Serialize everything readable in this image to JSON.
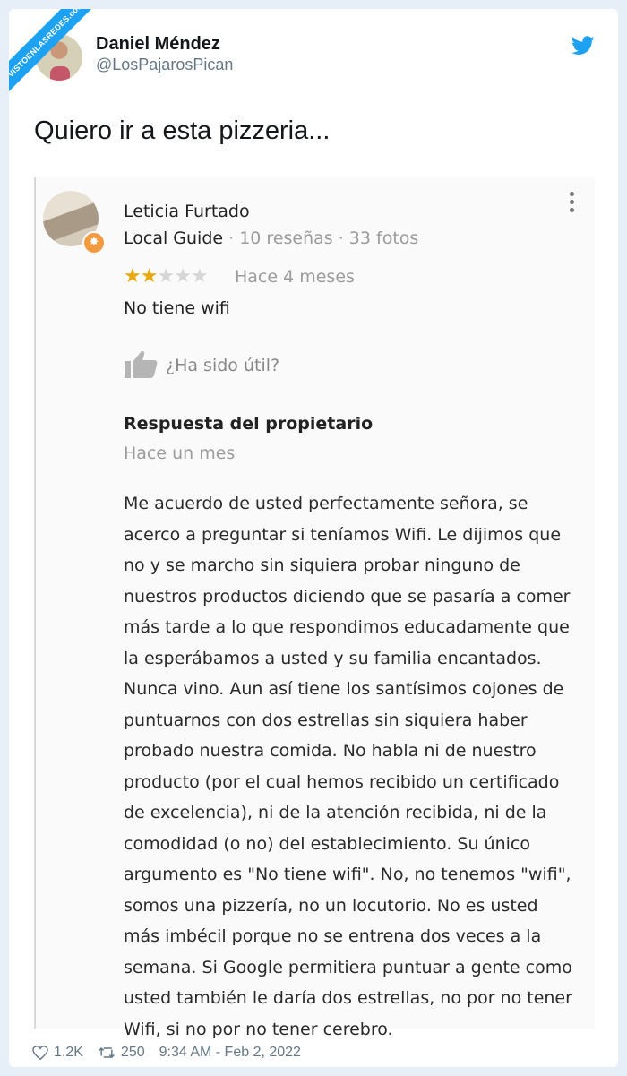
{
  "watermark": "VISTOENLASREDES.com",
  "tweet": {
    "author_name": "Daniel Méndez",
    "author_handle": "@LosPajarosPican",
    "text": "Quiero ir a esta pizzeria...",
    "likes": "1.2K",
    "retweets": "250",
    "timestamp": "9:34 AM - Feb 2, 2022"
  },
  "review": {
    "reviewer_name": "Leticia Furtado",
    "reviewer_level": "Local Guide",
    "reviewer_stats": "· 10 reseñas · 33 fotos",
    "rating": 2,
    "rating_max": 5,
    "time_ago": "Hace 4 meses",
    "text": "No tiene wifi",
    "helpful_label": "¿Ha sido útil?"
  },
  "owner_response": {
    "title": "Respuesta del propietario",
    "time_ago": "Hace un mes",
    "lines": [
      "Me acuerdo de usted perfectamente señora, se",
      "acerco a preguntar si teníamos Wifi. Le dijimos que",
      "no y se marcho sin siquiera probar ninguno de",
      "nuestros productos diciendo que se pasaría a comer",
      "más tarde a lo que respondimos educadamente que",
      "la esperábamos a usted y su familia encantados.",
      "Nunca vino. Aun así tiene los santísimos cojones de",
      "puntuarnos con dos estrellas sin siquiera haber",
      "probado nuestra comida. No habla ni de nuestro",
      "producto (por el cual hemos recibido un certificado",
      "de excelencia), ni de la atención recibida, ni de la",
      "comodidad (o no) del establecimiento. Su único",
      "argumento es \"No tiene wifi\". No, no tenemos \"wifi\",",
      "somos una pizzería, no un locutorio. No es usted",
      "más imbécil porque no se entrena dos veces a la",
      "semana. Si Google permitiera puntuar a gente como",
      "usted también le daría dos estrellas, no por no tener",
      "Wifi, si no por no tener cerebro."
    ]
  },
  "colors": {
    "twitter_blue": "#1da1f2",
    "star_on": "#e8a80f",
    "star_off": "#d6d6d6"
  }
}
